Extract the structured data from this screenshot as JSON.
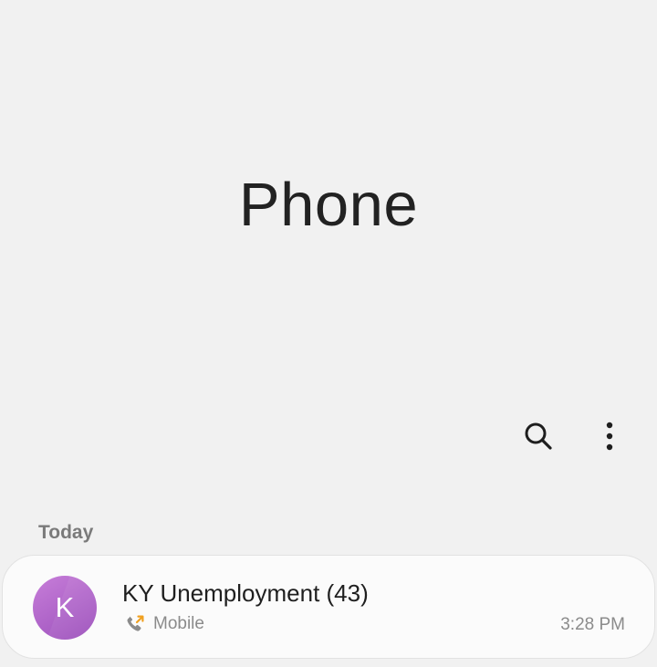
{
  "app": {
    "title": "Phone"
  },
  "toolbar": {
    "search_icon": "search-icon",
    "more_icon": "more-options-icon"
  },
  "call_log": {
    "section_header": "Today",
    "entries": [
      {
        "avatar_letter": "K",
        "name": "KY Unemployment (43)",
        "call_direction_icon": "outgoing-call-icon",
        "number_type": "Mobile",
        "time": "3:28 PM"
      }
    ]
  },
  "colors": {
    "background": "#f1f1f1",
    "avatar": "#b064cb",
    "outgoing_arrow": "#f0a020"
  }
}
